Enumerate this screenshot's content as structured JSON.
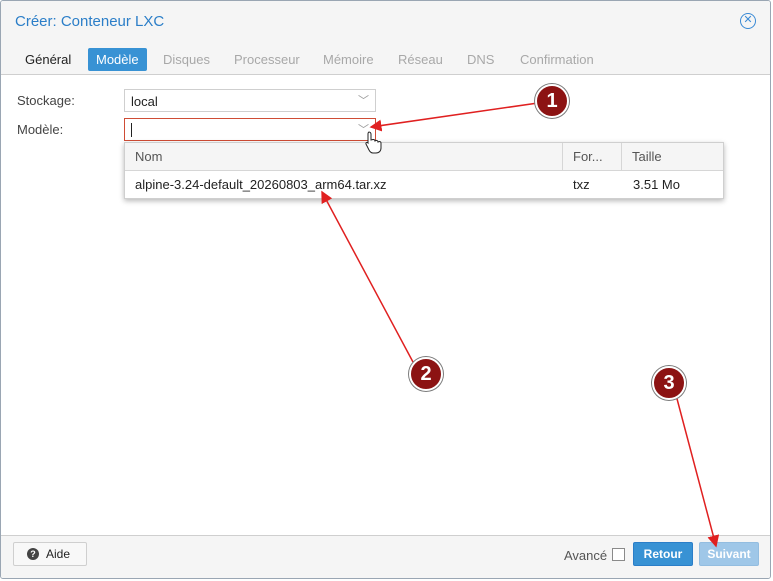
{
  "window": {
    "title": "Créer: Conteneur LXC",
    "close_icon": "close-icon"
  },
  "tabs": [
    {
      "label": "Général",
      "state": "normal"
    },
    {
      "label": "Modèle",
      "state": "active"
    },
    {
      "label": "Disques",
      "state": "disabled"
    },
    {
      "label": "Processeur",
      "state": "disabled"
    },
    {
      "label": "Mémoire",
      "state": "disabled"
    },
    {
      "label": "Réseau",
      "state": "disabled"
    },
    {
      "label": "DNS",
      "state": "disabled"
    },
    {
      "label": "Confirmation",
      "state": "disabled"
    }
  ],
  "form": {
    "storage": {
      "label": "Stockage:",
      "value": "local"
    },
    "template": {
      "label": "Modèle:",
      "value": ""
    }
  },
  "dropdown": {
    "columns": {
      "name": "Nom",
      "format": "For...",
      "size": "Taille"
    },
    "rows": [
      {
        "name": "alpine-3.24-default_20260803_arm64.tar.xz",
        "format": "txz",
        "size": "3.51 Mo"
      }
    ]
  },
  "footer": {
    "help_label": "Aide",
    "advanced_label": "Avancé",
    "advanced_checked": false,
    "back_label": "Retour",
    "next_label": "Suivant"
  },
  "annotations": {
    "steps": [
      "1",
      "2",
      "3"
    ],
    "marker_color": "#8c1313",
    "arrow_color": "#e02020"
  },
  "colors": {
    "accent": "#3892d4",
    "title": "#2b7ec8",
    "invalid_border": "#cf4c35"
  }
}
